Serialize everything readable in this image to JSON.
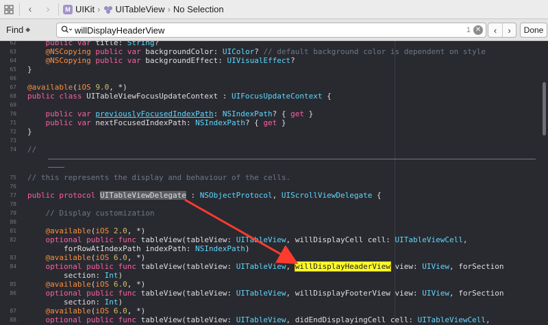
{
  "jumpbar": {
    "grid_icon": "grid-icon",
    "back_glyph": "‹",
    "forward_glyph": "›",
    "project": "UIKit",
    "project_icon_glyph": "M",
    "file": "UITableView",
    "selection": "No Selection"
  },
  "find": {
    "mode_label": "Find",
    "query": "willDisplayHeaderView",
    "match_count": "1",
    "prev_glyph": "‹",
    "next_glyph": "›",
    "done_label": "Done"
  },
  "editor": {
    "colors": {
      "background": "#292a30",
      "keyword": "#fc5fa3",
      "type": "#5dd8ff",
      "comment": "#6c7986",
      "attribute": "#fd8f3f",
      "number": "#d0bf69",
      "annotation_arrow": "#ff3b2f",
      "find_highlight": "#fefa2c"
    },
    "lines": [
      {
        "n": "62",
        "t": "    public var title: String?"
      },
      {
        "n": "63",
        "t": "    @NSCopying public var backgroundColor: UIColor? // default background color is dependent on style"
      },
      {
        "n": "64",
        "t": "    @NSCopying public var backgroundEffect: UIVisualEffect?"
      },
      {
        "n": "65",
        "t": "}"
      },
      {
        "n": "66",
        "t": ""
      },
      {
        "n": "67",
        "t": "@available(iOS 9.0, *)"
      },
      {
        "n": "68",
        "t": "public class UITableViewFocusUpdateContext : UIFocusUpdateContext {"
      },
      {
        "n": "69",
        "t": ""
      },
      {
        "n": "70",
        "t": "    public var previouslyFocusedIndexPath: NSIndexPath? { get }"
      },
      {
        "n": "71",
        "t": "    public var nextFocusedIndexPath: NSIndexPath? { get }"
      },
      {
        "n": "72",
        "t": "}"
      },
      {
        "n": "73",
        "t": ""
      },
      {
        "n": "74",
        "t": "//"
      },
      {
        "n": "75",
        "t": "// this represents the display and behaviour of the cells."
      },
      {
        "n": "76",
        "t": ""
      },
      {
        "n": "77",
        "t": "public protocol UITableViewDelegate : NSObjectProtocol, UIScrollViewDelegate {"
      },
      {
        "n": "78",
        "t": ""
      },
      {
        "n": "79",
        "t": "    // Display customization"
      },
      {
        "n": "80",
        "t": ""
      },
      {
        "n": "81",
        "t": "    @available(iOS 2.0, *)"
      },
      {
        "n": "82",
        "t": "    optional public func tableView(tableView: UITableView, willDisplayCell cell: UITableViewCell,"
      },
      {
        "n": "",
        "t": "        forRowAtIndexPath indexPath: NSIndexPath)"
      },
      {
        "n": "83",
        "t": "    @available(iOS 6.0, *)"
      },
      {
        "n": "84",
        "t": "    optional public func tableView(tableView: UITableView, willDisplayHeaderView view: UIView, forSection"
      },
      {
        "n": "",
        "t": "        section: Int)"
      },
      {
        "n": "85",
        "t": "    @available(iOS 6.0, *)"
      },
      {
        "n": "86",
        "t": "    optional public func tableView(tableView: UITableView, willDisplayFooterView view: UIView, forSection"
      },
      {
        "n": "",
        "t": "        section: Int)"
      },
      {
        "n": "87",
        "t": "    @available(iOS 6.0, *)"
      },
      {
        "n": "88",
        "t": "    optional public func tableView(tableView: UITableView, didEndDisplayingCell cell: UITableViewCell,"
      },
      {
        "n": "",
        "t": "        forRowAtIndexPath indexPath: NSIndexPath)"
      }
    ]
  }
}
